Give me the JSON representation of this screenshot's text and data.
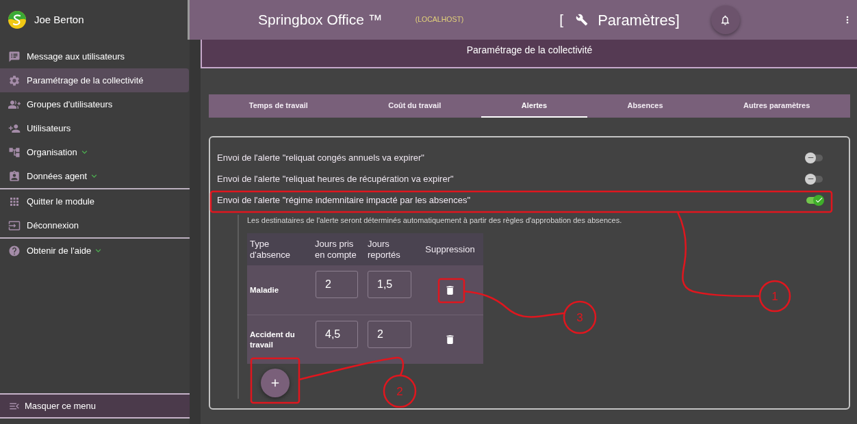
{
  "sidebar": {
    "user": "Joe Berton",
    "groups": [
      {
        "items": [
          {
            "label": "Message aux utilisateurs",
            "selected": false,
            "expandable": false
          },
          {
            "label": "Paramétrage de la collectivité",
            "selected": true,
            "expandable": false
          },
          {
            "label": "Groupes d'utilisateurs",
            "selected": false,
            "expandable": false
          },
          {
            "label": "Utilisateurs",
            "selected": false,
            "expandable": false
          },
          {
            "label": "Organisation",
            "selected": false,
            "expandable": true
          },
          {
            "label": "Données agent",
            "selected": false,
            "expandable": true
          }
        ]
      },
      {
        "items": [
          {
            "label": "Quitter le module",
            "selected": false,
            "expandable": false
          },
          {
            "label": "Déconnexion",
            "selected": false,
            "expandable": false
          }
        ]
      },
      {
        "items": [
          {
            "label": "Obtenir de l'aide",
            "selected": false,
            "expandable": true
          }
        ]
      }
    ],
    "collapse_button": "Masquer ce menu"
  },
  "header": {
    "app_title": "Springbox Office ™",
    "host": "(LOCALHOST)",
    "page_title_open": "[",
    "page_title": "Paramètres]"
  },
  "page_heading": "Paramétrage de la collectivité",
  "tabs": [
    {
      "label": "Temps de travail",
      "selected": false
    },
    {
      "label": "Coût du travail",
      "selected": false
    },
    {
      "label": "Alertes",
      "selected": true
    },
    {
      "label": "Absences",
      "selected": false
    },
    {
      "label": "Autres paramètres",
      "selected": false
    }
  ],
  "alerts": [
    {
      "label": "Envoi de l'alerte \"reliquat congés annuels va expirer\"",
      "on": false
    },
    {
      "label": "Envoi de l'alerte \"reliquat heures de récupération va expirer\"",
      "on": false
    },
    {
      "label": "Envoi de l'alerte \"régime indemnitaire impacté par les absences\"",
      "on": true,
      "note": "Les destinataires de l'alerte seront déterminés automatiquement à partir des règles d'approbation des absences.",
      "table": {
        "columns": [
          "Type d'absence",
          "Jours pris en compte",
          "Jours reportés",
          "Suppression"
        ],
        "rows": [
          {
            "type": "Maladie",
            "days_counted": "2",
            "days_carried": "1,5"
          },
          {
            "type": "Accident du travail",
            "days_counted": "4,5",
            "days_carried": "2"
          }
        ]
      }
    }
  ],
  "annotations": [
    {
      "number": "1"
    },
    {
      "number": "2"
    },
    {
      "number": "3"
    }
  ]
}
